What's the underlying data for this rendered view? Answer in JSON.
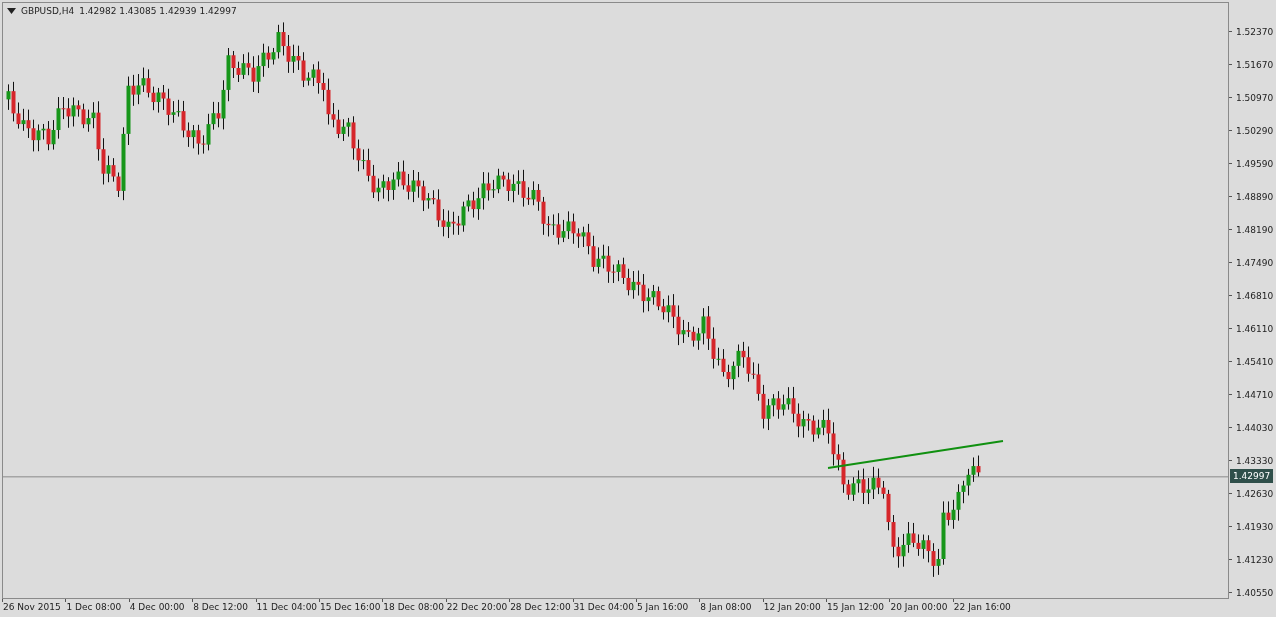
{
  "header": {
    "symbol": "GBPUSD,H4",
    "quotes": "1.42982 1.43085 1.42939 1.42997"
  },
  "price_axis": [
    "1.52370",
    "1.51670",
    "1.50970",
    "1.50290",
    "1.49590",
    "1.48890",
    "1.48190",
    "1.47490",
    "1.46810",
    "1.46110",
    "1.45410",
    "1.44710",
    "1.44030",
    "1.43330",
    "1.42630",
    "1.41930",
    "1.41230",
    "1.40550"
  ],
  "current_price": "1.42997",
  "time_axis": [
    "26 Nov 2015",
    "1 Dec 08:00",
    "4 Dec 00:00",
    "8 Dec 12:00",
    "11 Dec 04:00",
    "15 Dec 16:00",
    "18 Dec 08:00",
    "22 Dec 20:00",
    "28 Dec 12:00",
    "31 Dec 04:00",
    "5 Jan 16:00",
    "8 Jan 08:00",
    "12 Jan 20:00",
    "15 Jan 12:00",
    "20 Jan 00:00",
    "22 Jan 16:00"
  ]
}
